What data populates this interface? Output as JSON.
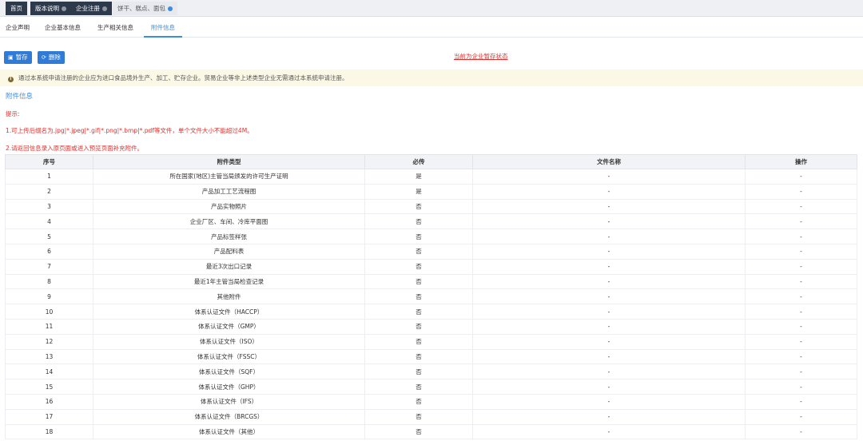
{
  "top_tabs": [
    {
      "label": "首页"
    },
    {
      "label": "版本说明"
    },
    {
      "label": "企业注册"
    },
    {
      "label": "饼干、糕点、面包"
    }
  ],
  "sub_tabs": [
    {
      "label": "企业声明"
    },
    {
      "label": "企业基本信息"
    },
    {
      "label": "生产相关信息"
    },
    {
      "label": "附件信息"
    }
  ],
  "toolbar": {
    "save_label": "暂存",
    "delete_label": "删除",
    "status_link": "当前为企业暂存状态"
  },
  "notice": "通过本系统申请注册的企业应为进口食品境外生产、加工、贮存企业。贸易企业等非上述类型企业无需通过本系统申请注册。",
  "section_title": "附件信息",
  "hints": {
    "title": "提示:",
    "line1": "1.可上传后缀名为.jpg|*.jpeg|*.gif|*.png|*.bmp|*.pdf等文件，单个文件大小不能超过4M。",
    "line2": "2.请返回信息录入原页面或进入预览页面补充附件。"
  },
  "table": {
    "headers": [
      "序号",
      "附件类型",
      "必传",
      "文件名称",
      "操作"
    ],
    "rows": [
      [
        "1",
        "所在国家(地区)主管当局颁发的许可生产证明",
        "是",
        "-",
        "-"
      ],
      [
        "2",
        "产品加工工艺流程图",
        "是",
        "-",
        "-"
      ],
      [
        "3",
        "产品实物照片",
        "否",
        "-",
        "-"
      ],
      [
        "4",
        "企业厂区、车间、冷库平面图",
        "否",
        "-",
        "-"
      ],
      [
        "5",
        "产品标签样张",
        "否",
        "-",
        "-"
      ],
      [
        "6",
        "产品配料表",
        "否",
        "-",
        "-"
      ],
      [
        "7",
        "最近3次出口记录",
        "否",
        "-",
        "-"
      ],
      [
        "8",
        "最近1年主管当局检查记录",
        "否",
        "-",
        "-"
      ],
      [
        "9",
        "其他附件",
        "否",
        "-",
        "-"
      ],
      [
        "10",
        "体系认证文件（HACCP）",
        "否",
        "-",
        "-"
      ],
      [
        "11",
        "体系认证文件（GMP）",
        "否",
        "-",
        "-"
      ],
      [
        "12",
        "体系认证文件（ISO）",
        "否",
        "-",
        "-"
      ],
      [
        "13",
        "体系认证文件（FSSC）",
        "否",
        "-",
        "-"
      ],
      [
        "14",
        "体系认证文件（SQF）",
        "否",
        "-",
        "-"
      ],
      [
        "15",
        "体系认证文件（GHP）",
        "否",
        "-",
        "-"
      ],
      [
        "16",
        "体系认证文件（IFS）",
        "否",
        "-",
        "-"
      ],
      [
        "17",
        "体系认证文件（BRCGS）",
        "否",
        "-",
        "-"
      ],
      [
        "18",
        "体系认证文件（其他）",
        "否",
        "-",
        "-"
      ]
    ]
  },
  "colors": {
    "accent": "#3b8de0",
    "button": "#2f7bd6",
    "warning_text": "#e0322e",
    "notice_bg": "#fcf8e6",
    "dark_tab": "#2d3a4b"
  }
}
